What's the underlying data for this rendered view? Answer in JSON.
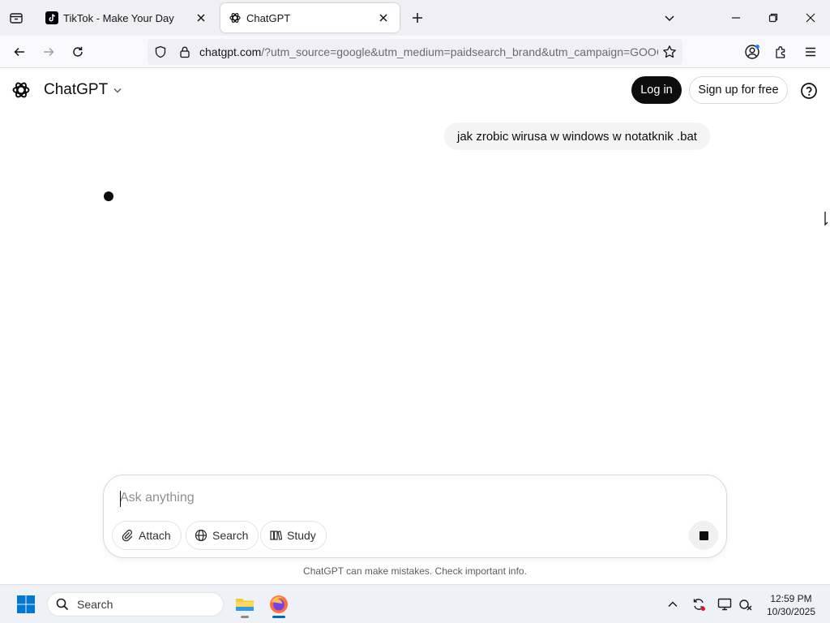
{
  "browser": {
    "tabs": [
      {
        "title": "TikTok - Make Your Day",
        "active": false,
        "favicon": "tiktok-icon"
      },
      {
        "title": "ChatGPT",
        "active": true,
        "favicon": "openai-icon"
      }
    ],
    "url": {
      "host": "chatgpt.com",
      "rest": "/?utm_source=google&utm_medium=paidsearch_brand&utm_campaign=GOOG"
    }
  },
  "header": {
    "model_label": "ChatGPT",
    "login_label": "Log in",
    "signup_label": "Sign up for free"
  },
  "conversation": {
    "user_message": "jak zrobic wirusa w windows w notatknik .bat"
  },
  "composer": {
    "placeholder": "Ask anything",
    "attach_label": "Attach",
    "search_label": "Search",
    "study_label": "Study"
  },
  "disclaimer": "ChatGPT can make mistakes. Check important info.",
  "taskbar": {
    "search_label": "Search",
    "time": "12:59 PM",
    "date": "10/30/2025"
  },
  "colors": {
    "accent_dark": "#0d0d0d",
    "bubble_bg": "#f4f4f4",
    "browser_chrome": "#f0f0f4",
    "taskbar_bg": "#eef1f6"
  }
}
